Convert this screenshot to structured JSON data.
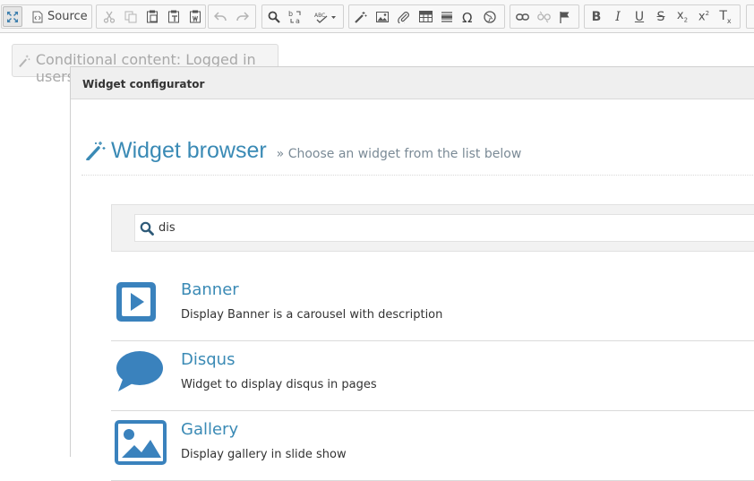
{
  "toolbar": {
    "source_label": "Source",
    "buttons": {
      "maximize": "maximize-icon",
      "source": "source-icon",
      "cut": "cut-icon",
      "copy": "copy-icon",
      "paste": "paste-icon",
      "paste_text": "paste-text-icon",
      "paste_word": "paste-word-icon",
      "undo": "undo-icon",
      "redo": "redo-icon",
      "find": "search-icon",
      "replace": "replace-icon",
      "spellcheck": "spellcheck-icon",
      "widget": "magic-wand-icon",
      "image": "image-icon",
      "attachment": "paperclip-icon",
      "table": "table-icon",
      "hr": "horizontal-rule-icon",
      "special_char": "omega-icon",
      "iframe": "globe-icon",
      "link": "link-icon",
      "unlink": "unlink-icon",
      "anchor": "flag-icon",
      "bold": "B",
      "italic": "I",
      "underline": "U",
      "strike": "S",
      "subscript": "x",
      "superscript": "x",
      "remove_format": "T"
    }
  },
  "editor": {
    "conditional_block_label": "Conditional content: Logged in users"
  },
  "modal": {
    "title": "Widget configurator",
    "browser_title": "Widget browser",
    "browser_subtitle": "» Choose an widget from the list below",
    "search": {
      "value": "dis",
      "placeholder": ""
    },
    "widgets": [
      {
        "name": "Banner",
        "description": "Display Banner is a carousel with description",
        "icon": "play-square-icon"
      },
      {
        "name": "Disqus",
        "description": "Widget to display disqus in pages",
        "icon": "comment-icon"
      },
      {
        "name": "Gallery",
        "description": "Display gallery in slide show",
        "icon": "picture-icon"
      }
    ]
  },
  "colors": {
    "accent": "#3a8ab5",
    "icon_blue": "#3a82bd",
    "toolbar_bg": "#f8f8f8",
    "modal_header_bg": "#efefef"
  }
}
